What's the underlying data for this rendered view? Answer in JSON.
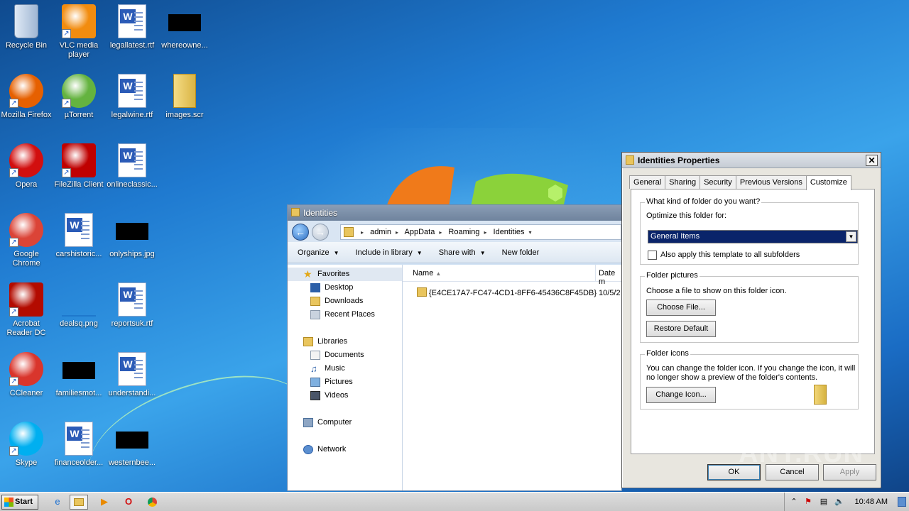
{
  "desktop": {
    "icons": [
      {
        "label": "Recycle Bin",
        "icon": "recycle-bin-icon"
      },
      {
        "label": "VLC media player",
        "icon": "vlc-icon"
      },
      {
        "label": "legallatest.rtf",
        "icon": "word-doc-icon"
      },
      {
        "label": "whereowne...",
        "icon": "redacted-thumbnail"
      },
      {
        "label": "Mozilla Firefox",
        "icon": "firefox-icon"
      },
      {
        "label": "µTorrent",
        "icon": "utorrent-icon"
      },
      {
        "label": "legalwine.rtf",
        "icon": "word-doc-icon"
      },
      {
        "label": "images.scr",
        "icon": "folder-icon"
      },
      {
        "label": "Opera",
        "icon": "opera-icon"
      },
      {
        "label": "FileZilla Client",
        "icon": "filezilla-icon"
      },
      {
        "label": "onlineclassic...",
        "icon": "word-doc-icon"
      },
      {
        "label": "Google Chrome",
        "icon": "chrome-icon"
      },
      {
        "label": "carshistoric...",
        "icon": "word-doc-icon"
      },
      {
        "label": "onlyships.jpg",
        "icon": "redacted-thumbnail"
      },
      {
        "label": "Acrobat Reader DC",
        "icon": "acrobat-icon"
      },
      {
        "label": "dealsq.png",
        "icon": "image-thumbnail"
      },
      {
        "label": "reportsuk.rtf",
        "icon": "word-doc-icon"
      },
      {
        "label": "CCleaner",
        "icon": "ccleaner-icon"
      },
      {
        "label": "familiesmot...",
        "icon": "redacted-thumbnail"
      },
      {
        "label": "understandi...",
        "icon": "word-doc-icon"
      },
      {
        "label": "Skype",
        "icon": "skype-icon"
      },
      {
        "label": "financeolder...",
        "icon": "word-doc-icon"
      },
      {
        "label": "westernbee...",
        "icon": "redacted-thumbnail"
      }
    ]
  },
  "explorer": {
    "title": "Identities",
    "address": [
      "admin",
      "AppData",
      "Roaming",
      "Identities"
    ],
    "commands": {
      "organize": "Organize",
      "include": "Include in library",
      "share": "Share with",
      "new_folder": "New folder"
    },
    "nav": {
      "favorites": "Favorites",
      "desktop": "Desktop",
      "downloads": "Downloads",
      "recent": "Recent Places",
      "libraries": "Libraries",
      "documents": "Documents",
      "music": "Music",
      "pictures": "Pictures",
      "videos": "Videos",
      "computer": "Computer",
      "network": "Network"
    },
    "columns": {
      "name": "Name",
      "date": "Date m"
    },
    "rows": [
      {
        "name": "{E4CE17A7-FC47-4CD1-8FF6-45436C8F45DB}",
        "date": "10/5/2"
      }
    ]
  },
  "properties": {
    "title": "Identities Properties",
    "tabs": [
      "General",
      "Sharing",
      "Security",
      "Previous Versions",
      "Customize"
    ],
    "active_tab": "Customize",
    "kind": {
      "legend": "What kind of folder do you want?",
      "optimize_label": "Optimize this folder for:",
      "selected": "General Items",
      "apply_all": "Also apply this template to all subfolders",
      "apply_all_checked": false
    },
    "pictures": {
      "legend": "Folder pictures",
      "desc": "Choose a file to show on this folder icon.",
      "choose": "Choose File...",
      "restore": "Restore Default"
    },
    "icons": {
      "legend": "Folder icons",
      "desc1": "You can change the folder icon. If you change the icon, it will",
      "desc2": "no longer show a preview of the folder's contents.",
      "change": "Change Icon..."
    },
    "buttons": {
      "ok": "OK",
      "cancel": "Cancel",
      "apply": "Apply"
    }
  },
  "taskbar": {
    "start": "Start",
    "clock": "10:48 AM"
  },
  "watermark": "ANY.RUN"
}
